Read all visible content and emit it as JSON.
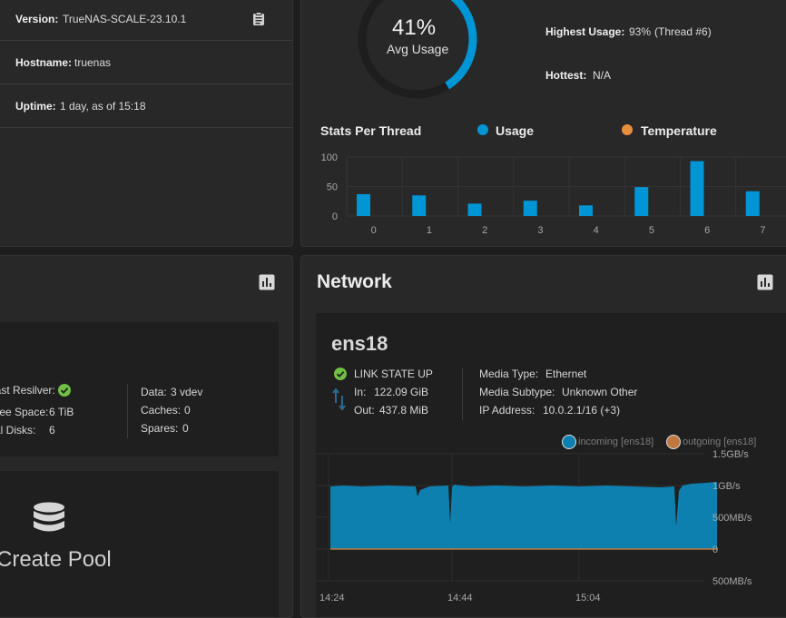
{
  "system_info": {
    "version_label": "Version:",
    "version": "TrueNAS-SCALE-23.10.1",
    "hostname_label": "Hostname:",
    "hostname": "truenas",
    "uptime_label": "Uptime:",
    "uptime": "1 day, as of 15:18"
  },
  "cpu": {
    "usage_percent_text": "41%",
    "usage_fraction": 0.41,
    "usage_caption": "Avg Usage",
    "highest_usage_label": "Highest Usage:",
    "highest_usage_value": "93%",
    "highest_usage_thread": "(Thread #6)",
    "hottest_label": "Hottest:",
    "hottest_value": "N/A",
    "stats_title": "Stats Per Thread",
    "legend_usage": "Usage",
    "legend_temperature": "Temperature",
    "colors": {
      "usage": "#0095d5",
      "temperature": "#e88e3d",
      "ring_track": "#1e1e1e"
    }
  },
  "chart_data": {
    "type": "bar",
    "categories": [
      "0",
      "1",
      "2",
      "3",
      "4",
      "5",
      "6",
      "7"
    ],
    "series": [
      {
        "name": "Usage",
        "values": [
          37,
          35,
          21,
          26,
          18,
          49,
          93,
          42
        ]
      }
    ],
    "yticks": [
      "100",
      "50",
      "0"
    ],
    "ylim": [
      0,
      100
    ],
    "grid": true
  },
  "storage": {
    "last_resilver_label": "Last Resilver:",
    "free_space_label": "Free Space:",
    "free_space": "6 TiB",
    "total_disks_label": "Total Disks:",
    "total_disks": "6",
    "data_label": "Data:",
    "data_value": "3 vdev",
    "caches_label": "Caches:",
    "caches_value": "0",
    "spares_label": "Spares:",
    "spares_value": "0",
    "create_pool_label": "Create Pool"
  },
  "network": {
    "title": "Network",
    "interface": "ens18",
    "link_state": "LINK STATE UP",
    "in_label": "In:",
    "in_value": "122.09 GiB",
    "out_label": "Out:",
    "out_value": "437.8 MiB",
    "media_type_label": "Media Type:",
    "media_type": "Ethernet",
    "media_subtype_label": "Media Subtype:",
    "media_subtype": "Unknown Other",
    "ip_label": "IP Address:",
    "ip_value": "10.0.2.1/16 (+3)",
    "legend_incoming": "incoming [ens18]",
    "legend_outgoing": "outgoing [ens18]",
    "y_ticks": [
      "1.5GB/s",
      "1GB/s",
      "500MB/s",
      "0",
      "500MB/s"
    ],
    "x_ticks": [
      "14:24",
      "14:44",
      "15:04"
    ],
    "colors": {
      "incoming": "#0e80b0",
      "outgoing": "#c07840"
    }
  }
}
